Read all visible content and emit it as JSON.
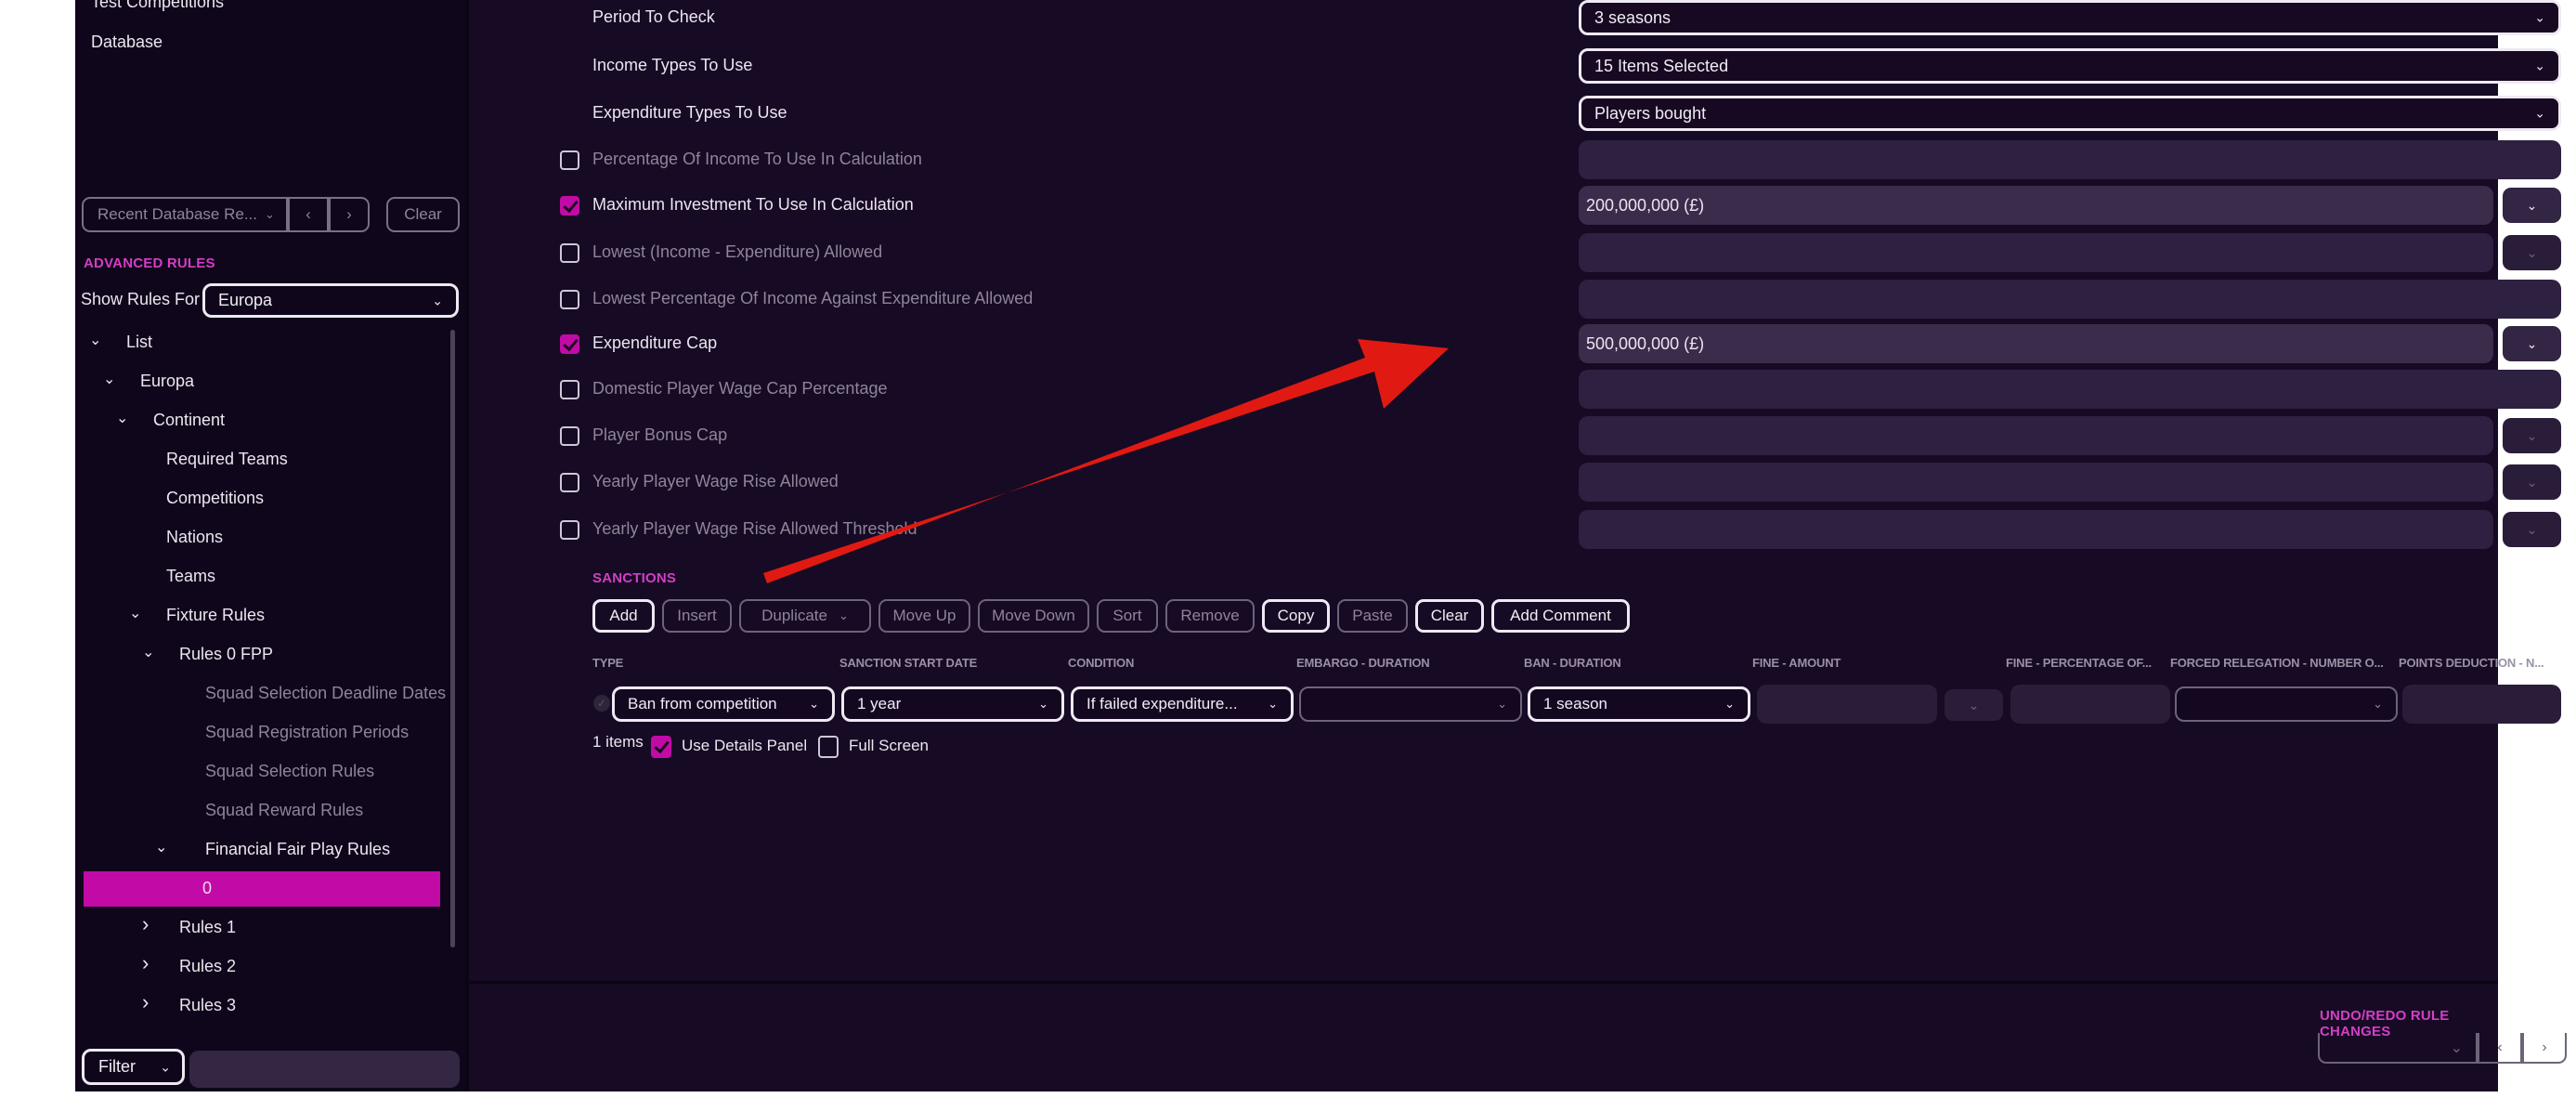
{
  "colors": {
    "accent": "#d23fc6",
    "selection": "#c20aa6",
    "arrow": "#e01a12",
    "background": "#170a24"
  },
  "sidebar": {
    "links": [
      "Test Competitions",
      "Database"
    ],
    "recent": {
      "label": "Recent Database Re...",
      "prev_icon": "chevron-left",
      "next_icon": "chevron-right",
      "clear_label": "Clear"
    },
    "advanced_rules_title": "ADVANCED RULES",
    "show_rules_for_label": "Show Rules For",
    "show_rules_for_value": "Europa",
    "tree": [
      {
        "label": "List",
        "expanded": true,
        "level": 0
      },
      {
        "label": "Europa",
        "expanded": true,
        "level": 1
      },
      {
        "label": "Continent",
        "expanded": true,
        "level": 2
      },
      {
        "label": "Required Teams",
        "level": 3
      },
      {
        "label": "Competitions",
        "level": 3
      },
      {
        "label": "Nations",
        "level": 3
      },
      {
        "label": "Teams",
        "level": 3
      },
      {
        "label": "Fixture Rules",
        "expanded": true,
        "level": 3
      },
      {
        "label": "Rules 0 FPP",
        "expanded": true,
        "level": 4
      },
      {
        "label": "Squad Selection Deadline Dates",
        "level": 5,
        "dim": true
      },
      {
        "label": "Squad Registration Periods",
        "level": 5,
        "dim": true
      },
      {
        "label": "Squad Selection Rules",
        "level": 5,
        "dim": true
      },
      {
        "label": "Squad Reward Rules",
        "level": 5,
        "dim": true
      },
      {
        "label": "Financial Fair Play Rules",
        "expanded": true,
        "level": 5
      },
      {
        "label": "0",
        "level": 6,
        "selected": true
      },
      {
        "label": "Rules 1",
        "expanded": false,
        "level": 4
      },
      {
        "label": "Rules 2",
        "expanded": false,
        "level": 4
      },
      {
        "label": "Rules 3",
        "expanded": false,
        "level": 4
      }
    ],
    "filter_label": "Filter",
    "filter_value": ""
  },
  "form": {
    "rows": [
      {
        "label": "Period To Check",
        "checkbox": null,
        "value": "3 seasons",
        "kind": "select"
      },
      {
        "label": "Income Types To Use",
        "checkbox": null,
        "value": "15 Items Selected",
        "kind": "select"
      },
      {
        "label": "Expenditure Types To Use",
        "checkbox": null,
        "value": "Players bought",
        "kind": "select"
      },
      {
        "label": "Percentage Of Income To Use In Calculation",
        "checkbox": false,
        "value": "",
        "kind": "input"
      },
      {
        "label": "Maximum Investment To Use In Calculation",
        "checkbox": true,
        "value": "200,000,000 (£)",
        "kind": "input-dropdown"
      },
      {
        "label": "Lowest (Income - Expenditure) Allowed",
        "checkbox": false,
        "value": "",
        "kind": "input-dropdown"
      },
      {
        "label": "Lowest Percentage Of Income Against Expenditure Allowed",
        "checkbox": false,
        "value": "",
        "kind": "input"
      },
      {
        "label": "Expenditure Cap",
        "checkbox": true,
        "value": "500,000,000 (£)",
        "kind": "input-dropdown"
      },
      {
        "label": "Domestic Player Wage Cap Percentage",
        "checkbox": false,
        "value": "",
        "kind": "input"
      },
      {
        "label": "Player Bonus Cap",
        "checkbox": false,
        "value": "",
        "kind": "input-dropdown"
      },
      {
        "label": "Yearly Player Wage Rise Allowed",
        "checkbox": false,
        "value": "",
        "kind": "input-dropdown"
      },
      {
        "label": "Yearly Player Wage Rise Allowed Threshold",
        "checkbox": false,
        "value": "",
        "kind": "input-dropdown"
      }
    ]
  },
  "sanctions": {
    "title": "SANCTIONS",
    "toolbar": [
      {
        "label": "Add",
        "enabled": true
      },
      {
        "label": "Insert",
        "enabled": false
      },
      {
        "label": "Duplicate",
        "enabled": false,
        "dropdown": true
      },
      {
        "label": "Move Up",
        "enabled": false
      },
      {
        "label": "Move Down",
        "enabled": false
      },
      {
        "label": "Sort",
        "enabled": false
      },
      {
        "label": "Remove",
        "enabled": false
      },
      {
        "label": "Copy",
        "enabled": true
      },
      {
        "label": "Paste",
        "enabled": false
      },
      {
        "label": "Clear",
        "enabled": true
      },
      {
        "label": "Add Comment",
        "enabled": true
      }
    ],
    "columns": [
      "TYPE",
      "SANCTION START DATE",
      "CONDITION",
      "EMBARGO - DURATION",
      "BAN - DURATION",
      "FINE - AMOUNT",
      "FINE - PERCENTAGE OF...",
      "FORCED RELEGATION - NUMBER O...",
      "POINTS DEDUCTION - N..."
    ],
    "row": {
      "type": "Ban from competition",
      "start_date": "1 year",
      "condition": "If failed expenditure...",
      "embargo_duration": "",
      "ban_duration": "1 season",
      "fine_amount": "",
      "fine_percentage": "",
      "forced_relegation": "",
      "points_deduction": ""
    },
    "items_count": "1 items",
    "use_details_panel_label": "Use Details Panel",
    "use_details_panel": true,
    "full_screen_label": "Full Screen",
    "full_screen": false
  },
  "undo": {
    "title": "UNDO/REDO RULE CHANGES",
    "value": ""
  },
  "icons": {
    "chevron_down": "⌄",
    "chevron_left": "‹",
    "chevron_right": "›",
    "check": "✓"
  }
}
